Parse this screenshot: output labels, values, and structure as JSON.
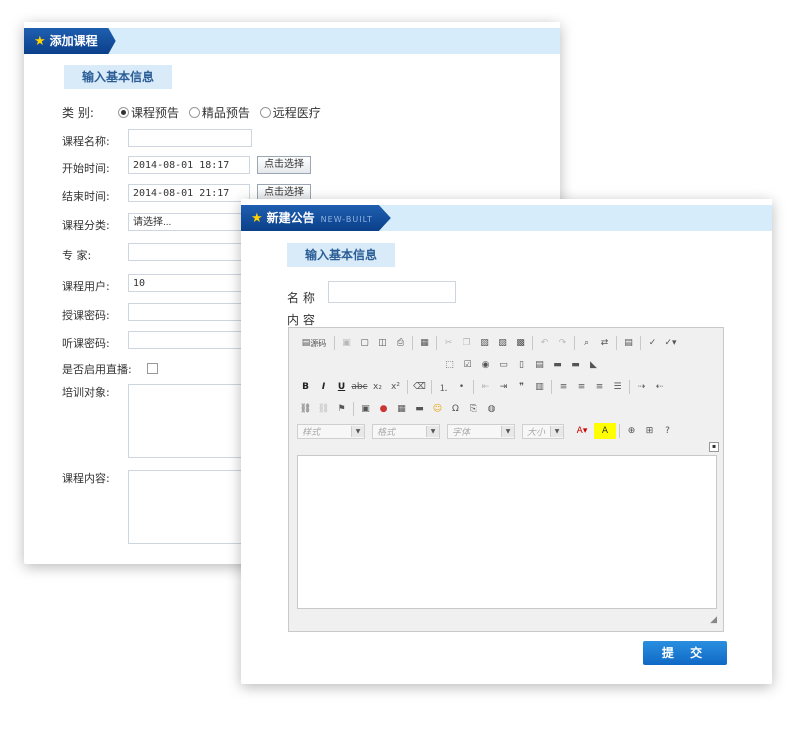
{
  "back_panel": {
    "title": "添加课程",
    "section": "输入基本信息",
    "category_label": "类 别:",
    "category_options": [
      "课程预告",
      "精品预告",
      "远程医疗"
    ],
    "name_label": "课程名称:",
    "start_label": "开始时间:",
    "start_value": "2014-08-01 18:17",
    "end_label": "结束时间:",
    "end_value": "2014-08-01 21:17",
    "pick_button": "点击选择",
    "pick_button_partial": "点击选择",
    "classify_label": "课程分类:",
    "classify_value": "请选择...",
    "expert_label": "专 家:",
    "users_label": "课程用户:",
    "users_value": "10",
    "teach_pwd_label": "授课密码:",
    "listen_pwd_label": "听课密码:",
    "live_label": "是否启用直播:",
    "target_label": "培训对象:",
    "content_label": "课程内容:"
  },
  "front_panel": {
    "title": "新建公告",
    "title_en": "NEW-BUILT",
    "section": "输入基本信息",
    "name_label": "名 称",
    "content_label": "内 容",
    "submit": "提 交",
    "editor": {
      "source_label": "源码",
      "combo_style": "样式",
      "combo_format": "格式",
      "combo_font": "字体",
      "combo_size": "大小"
    }
  }
}
